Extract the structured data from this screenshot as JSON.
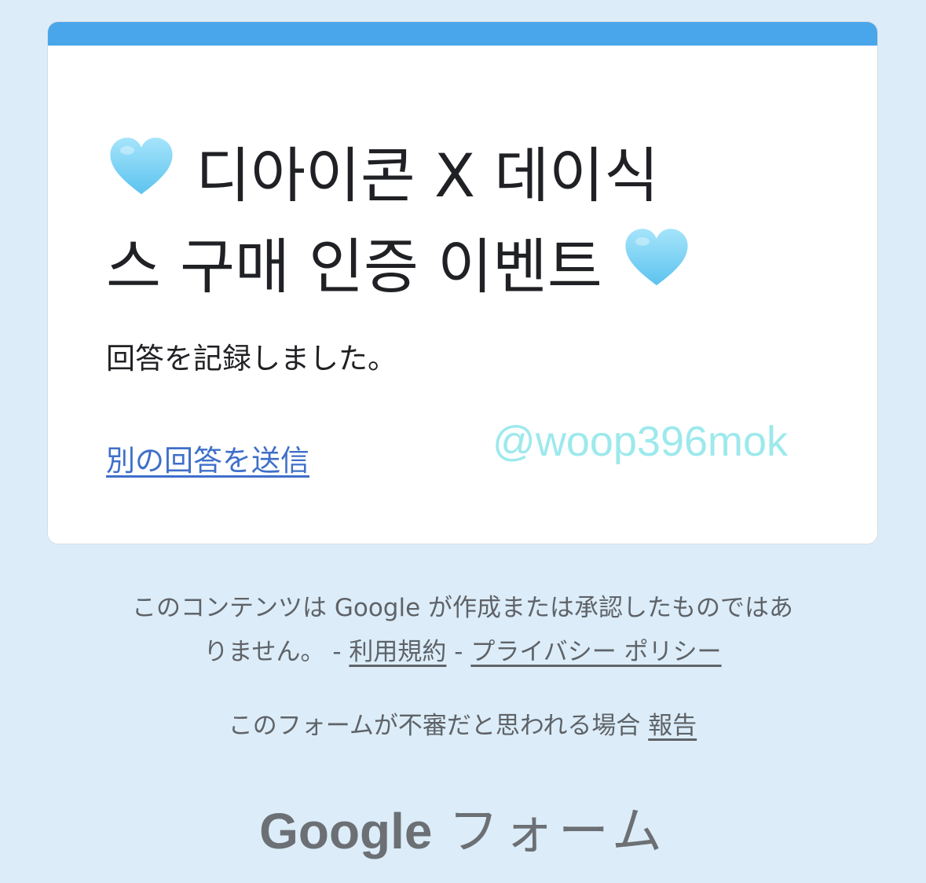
{
  "form": {
    "title_line1": "디아이콘 X 데이식",
    "title_line2": "스 구매 인증 이벤트",
    "title_icon": "light-blue-heart-emoji",
    "confirmation": "回答を記録しました。",
    "resubmit_link": "別の回答を送信",
    "accent_color": "#4aa6ea",
    "link_color": "#3f6fc9"
  },
  "watermark": "@woop396mok",
  "footer": {
    "disclaimer_part1": "このコンテンツは Google が作成または承認したものではあ",
    "disclaimer_part2": "りません。 -",
    "terms_link": "利用規約",
    "separator": "-",
    "privacy_link": "プライバシー ポリシー",
    "report_text": "このフォームが不審だと思われる場合",
    "report_link": "報告"
  },
  "brand": {
    "google": "Google",
    "forms": "フォーム"
  },
  "colors": {
    "background": "#dcedf9",
    "heart": "#7dd3f5"
  }
}
